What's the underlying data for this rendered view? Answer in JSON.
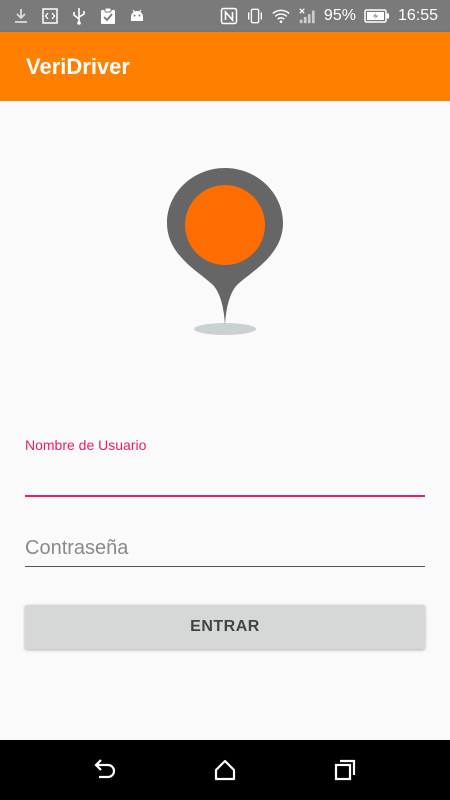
{
  "status_bar": {
    "battery_percent": "95%",
    "time": "16:55",
    "icons": [
      "download-icon",
      "code-icon",
      "usb-icon",
      "clipboard-check-icon",
      "android-icon",
      "nfc-icon",
      "vibrate-icon",
      "wifi-icon",
      "signal-icon",
      "battery-charging-icon"
    ]
  },
  "app_bar": {
    "title": "VeriDriver"
  },
  "logo": {
    "icon": "location-pin-icon",
    "pin_color": "#666666",
    "dot_color": "#ff6d00",
    "shadow_color": "#c9d1d3"
  },
  "form": {
    "username": {
      "label": "Nombre de Usuario",
      "value": ""
    },
    "password": {
      "placeholder": "Contraseña",
      "value": ""
    },
    "submit_label": "ENTRAR"
  },
  "nav_bar": {
    "buttons": [
      "back-icon",
      "home-icon",
      "recents-icon"
    ]
  },
  "colors": {
    "primary": "#ff7f00",
    "accent": "#e91e63",
    "status_bar": "#7a7a7a"
  }
}
